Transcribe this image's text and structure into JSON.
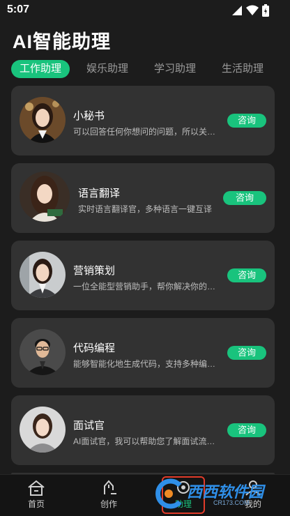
{
  "status_bar": {
    "time": "5:07"
  },
  "header": {
    "title": "AI智能助理"
  },
  "tabs": [
    {
      "label": "工作助理",
      "active": true
    },
    {
      "label": "娱乐助理",
      "active": false
    },
    {
      "label": "学习助理",
      "active": false
    },
    {
      "label": "生活助理",
      "active": false
    }
  ],
  "assistants": [
    {
      "name": "小秘书",
      "desc": "可以回答任何你想问的问题，所以关…",
      "button": "咨询"
    },
    {
      "name": "语言翻译",
      "desc": "实时语言翻译官，多种语言一键互译",
      "button": "咨询"
    },
    {
      "name": "营销策划",
      "desc": "一位全能型营销助手，帮你解决你的…",
      "button": "咨询"
    },
    {
      "name": "代码编程",
      "desc": "能够智能化地生成代码，支持多种编…",
      "button": "咨询"
    },
    {
      "name": "面试官",
      "desc": "AI面试官，我可以帮助您了解面试流…",
      "button": "咨询"
    }
  ],
  "bottom_nav": [
    {
      "label": "首页",
      "icon": "home-icon"
    },
    {
      "label": "创作",
      "icon": "pen-icon"
    },
    {
      "label": "助理",
      "icon": "assistant-icon",
      "active": true
    },
    {
      "label": "我的",
      "icon": "profile-icon"
    }
  ],
  "watermark": {
    "name": "西西软件园",
    "url": "CR173.COM"
  },
  "colors": {
    "accent": "#19c37d",
    "background": "#1c1c1c",
    "card": "#323232",
    "highlight_box": "#e23b2a"
  }
}
